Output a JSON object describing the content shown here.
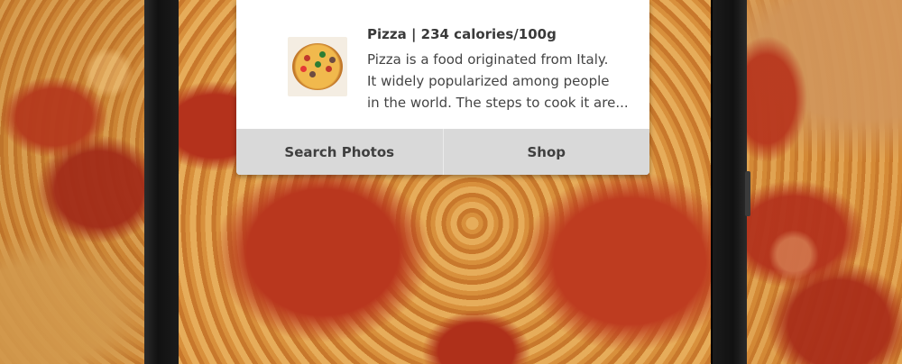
{
  "result_card": {
    "title": "Pizza | 234 calories/100g",
    "description_lines": [
      "Pizza is a food originated from Italy.",
      "It widely popularized among people",
      "in the world. The steps to cook it are..."
    ],
    "thumbnail_icon": "pizza-thumbnail"
  },
  "actions": {
    "search_photos_label": "Search Photos",
    "shop_label": "Shop"
  },
  "colors": {
    "card_background": "#ffffff",
    "action_bar_background": "#d9d9d9",
    "title_text": "#3a3a3a",
    "body_text": "#444444"
  }
}
